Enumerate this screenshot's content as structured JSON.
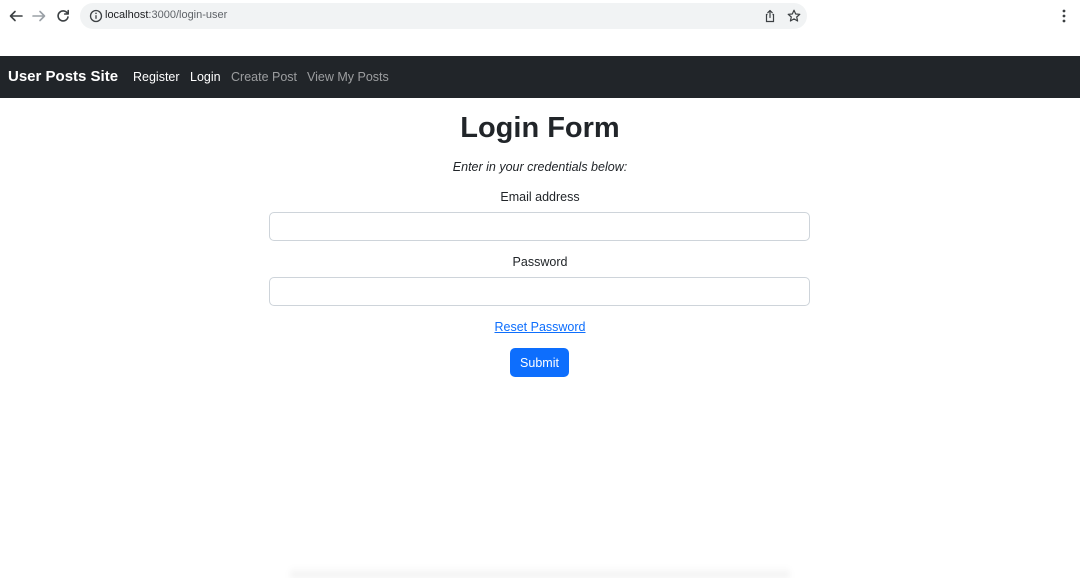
{
  "browser": {
    "url_host": "localhost",
    "url_rest": ":3000/login-user"
  },
  "navbar": {
    "brand": "User Posts Site",
    "links": [
      {
        "label": "Register",
        "state": "active"
      },
      {
        "label": "Login",
        "state": "active"
      },
      {
        "label": "Create Post",
        "state": "muted"
      },
      {
        "label": "View My Posts",
        "state": "muted"
      }
    ]
  },
  "form": {
    "title": "Login Form",
    "subtitle": "Enter in your credentials below:",
    "email_label": "Email address",
    "email_value": "",
    "password_label": "Password",
    "password_value": "",
    "reset_link": "Reset Password",
    "submit_label": "Submit"
  },
  "colors": {
    "navbar_bg": "#212529",
    "primary": "#0d6efd",
    "omnibox_bg": "#f1f3f4"
  },
  "icons": [
    "back-arrow-icon",
    "forward-arrow-icon",
    "reload-icon",
    "info-icon",
    "share-icon",
    "star-icon",
    "kebab-menu-icon"
  ]
}
